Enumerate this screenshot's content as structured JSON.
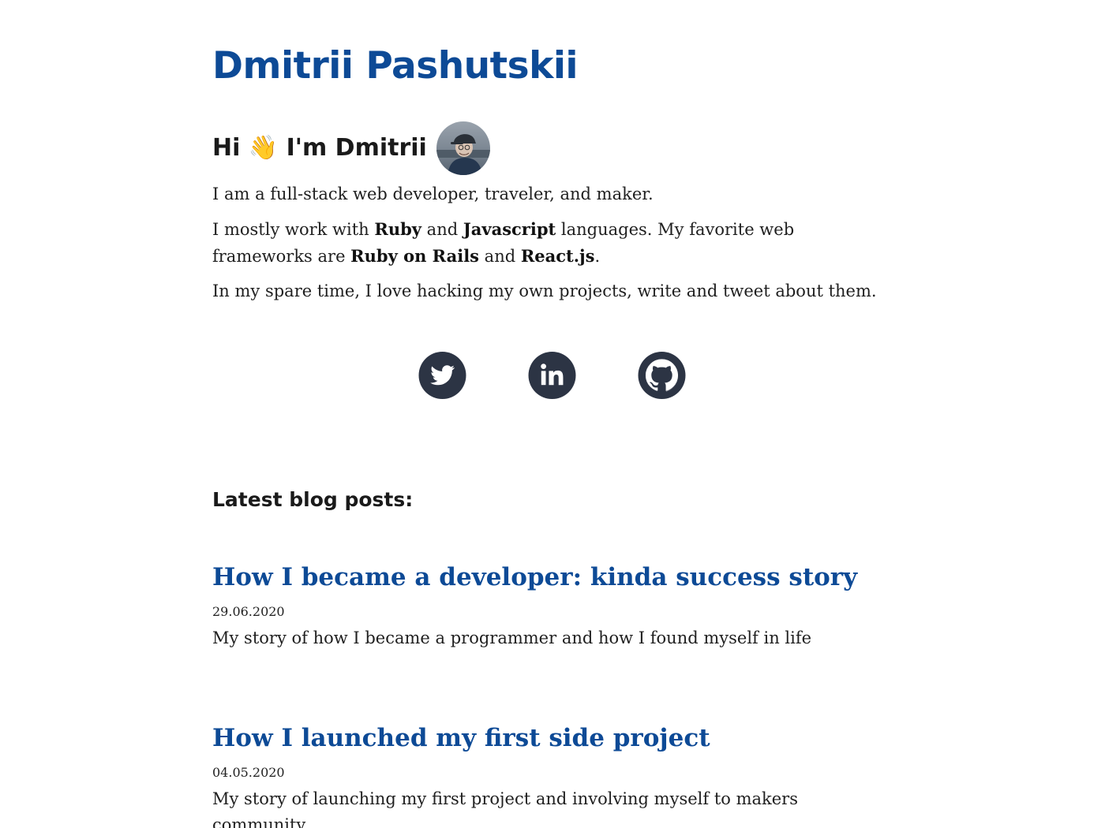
{
  "site": {
    "title": "Dmitrii Pashutskii"
  },
  "hero": {
    "greeting": "Hi 👋 I'm Dmitrii",
    "avatar_alt": "Dmitrii avatar",
    "intro_line": "I am a full-stack web developer, traveler, and maker.",
    "stack": {
      "t1": "I mostly work with ",
      "lang1": "Ruby",
      "t2": " and ",
      "lang2": "Javascript",
      "t3": " languages. My favorite web frameworks are ",
      "fw1": "Ruby on Rails",
      "t4": " and ",
      "fw2": "React.js",
      "t5": "."
    },
    "spare_time": "In my spare time, I love hacking my own projects, write and tweet about them."
  },
  "social": {
    "icon_color": "#2c3444",
    "links": [
      {
        "icon": "twitter-icon"
      },
      {
        "icon": "linkedin-icon"
      },
      {
        "icon": "github-icon"
      }
    ]
  },
  "blog": {
    "heading": "Latest blog posts:",
    "posts": [
      {
        "title": "How I became a developer: kinda success story",
        "date": "29.06.2020",
        "description": "My story of how I became a programmer and how I found myself in life"
      },
      {
        "title": "How I launched my first side project",
        "date": "04.05.2020",
        "description": "My story of launching my first project and involving myself to makers community"
      }
    ]
  },
  "colors": {
    "accent": "#0d4a96",
    "text": "#1f1f1f"
  }
}
